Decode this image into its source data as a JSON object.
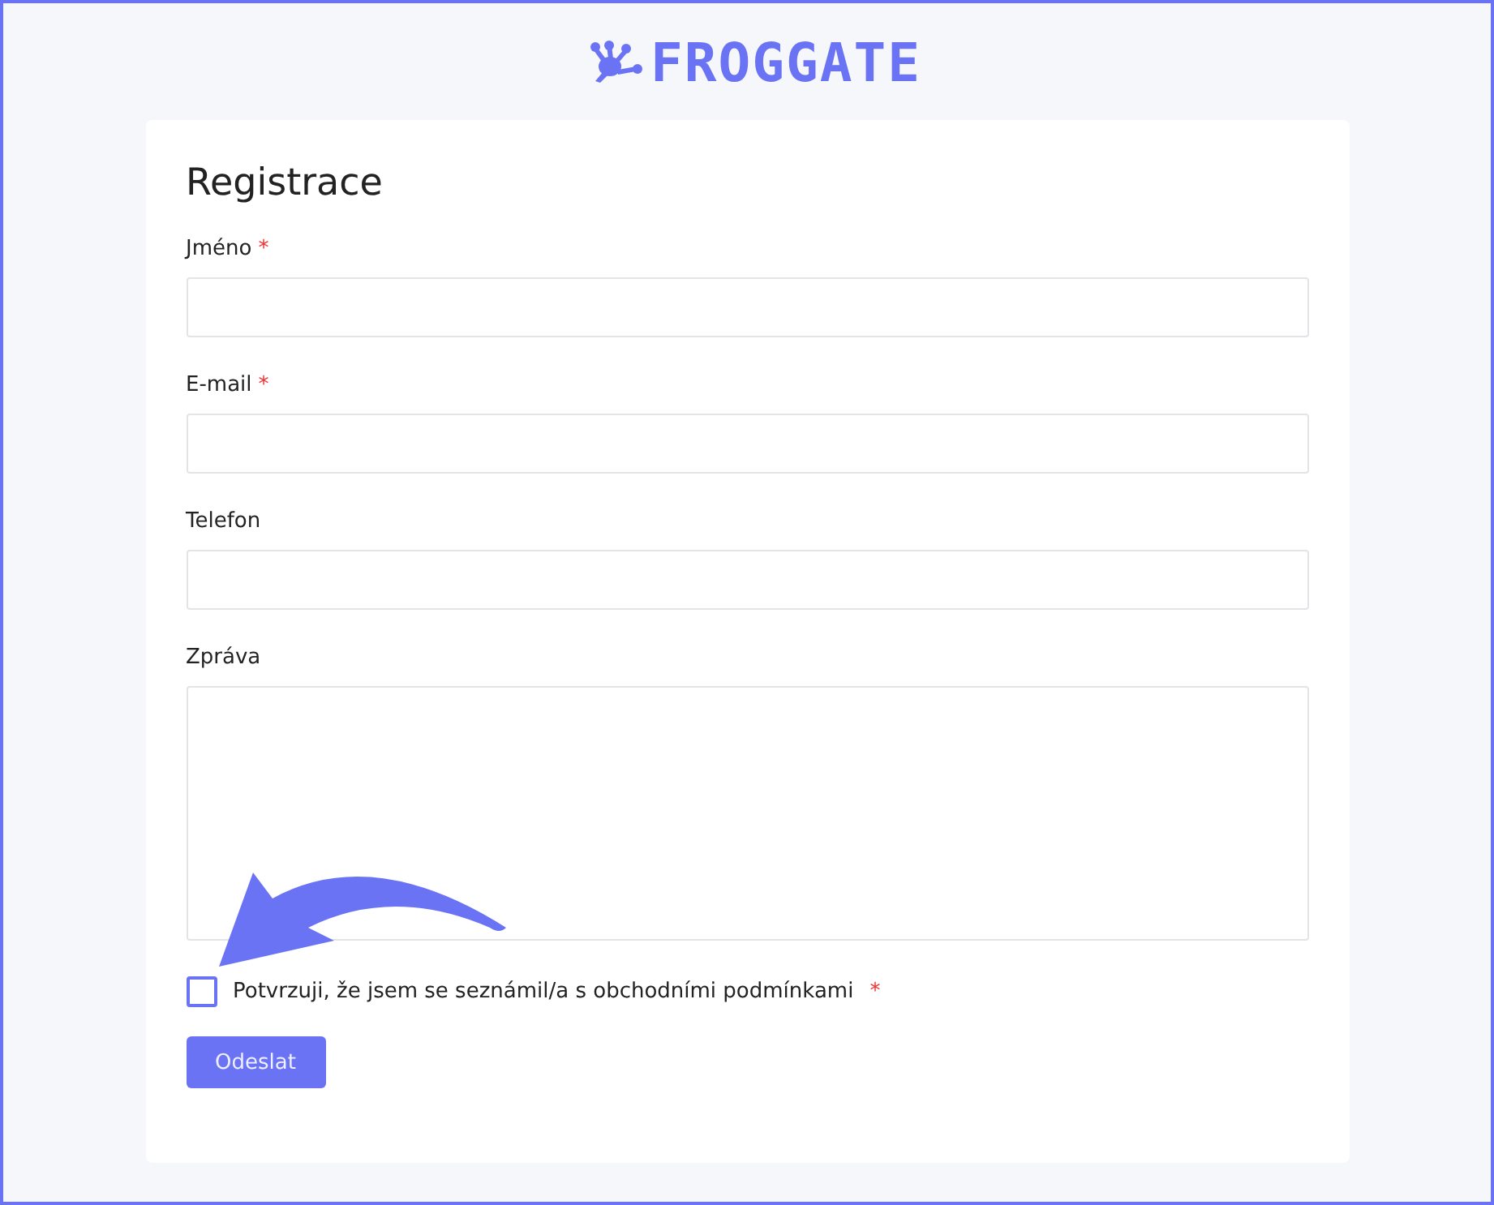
{
  "logo": {
    "text": "FROGGATE"
  },
  "form": {
    "title": "Registrace",
    "required_mark": "*",
    "fields": [
      {
        "label": "Jméno",
        "required": true,
        "kind": "input"
      },
      {
        "label": "E-mail",
        "required": true,
        "kind": "input"
      },
      {
        "label": "Telefon",
        "required": false,
        "kind": "input"
      },
      {
        "label": "Zpráva",
        "required": false,
        "kind": "textarea"
      }
    ],
    "consent": {
      "label": "Potvrzuji, že jsem se seznámil/a s obchodními podmínkami",
      "required": true,
      "checked": false
    },
    "submit": "Odeslat"
  }
}
